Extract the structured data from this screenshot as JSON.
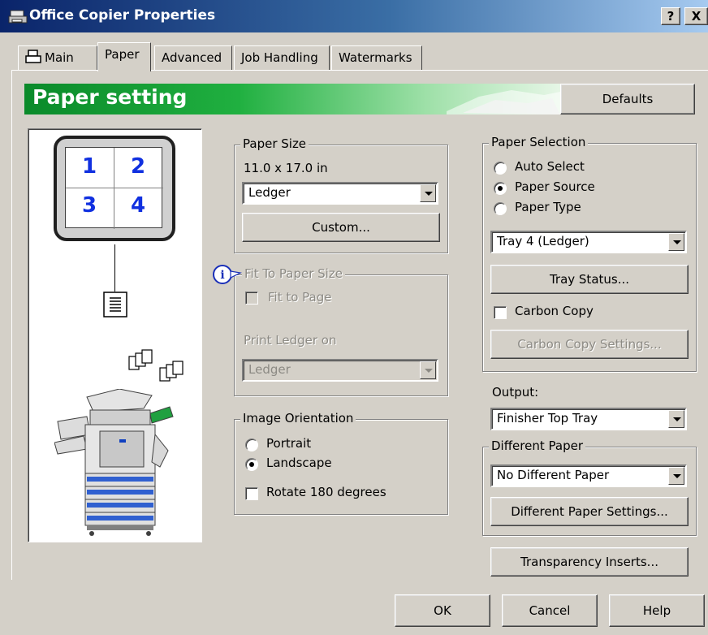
{
  "window": {
    "title": "Office Copier Properties",
    "help_button": "?",
    "close_button": "X"
  },
  "tabs": [
    {
      "label": "Main",
      "icon": "printer-icon"
    },
    {
      "label": "Paper",
      "active": true
    },
    {
      "label": "Advanced"
    },
    {
      "label": "Job Handling"
    },
    {
      "label": "Watermarks"
    }
  ],
  "banner": {
    "title": "Paper setting",
    "defaults_button": "Defaults"
  },
  "preview": {
    "page_numbers": [
      "1",
      "2",
      "3",
      "4"
    ]
  },
  "paper_size": {
    "legend": "Paper Size",
    "dimensions": "11.0 x 17.0 in",
    "selected": "Ledger",
    "custom_button": "Custom..."
  },
  "fit_to_paper": {
    "legend": "Fit To Paper Size",
    "fit_to_page_label": "Fit to Page",
    "fit_to_page_checked": false,
    "print_on_label": "Print Ledger on",
    "print_on_selected": "Ledger",
    "info_icon": "info-icon"
  },
  "image_orientation": {
    "legend": "Image Orientation",
    "options": [
      "Portrait",
      "Landscape"
    ],
    "selected": "Landscape",
    "rotate_label": "Rotate 180 degrees",
    "rotate_checked": false
  },
  "paper_selection": {
    "legend": "Paper Selection",
    "options": [
      "Auto Select",
      "Paper Source",
      "Paper Type"
    ],
    "selected": "Paper Source",
    "tray_selected": "Tray 4 (Ledger)",
    "tray_status_button": "Tray Status...",
    "carbon_copy_label": "Carbon Copy",
    "carbon_copy_checked": false,
    "carbon_copy_settings_button": "Carbon Copy Settings..."
  },
  "output": {
    "label": "Output:",
    "selected": "Finisher Top Tray"
  },
  "different_paper": {
    "legend": "Different Paper",
    "selected": "No Different Paper",
    "settings_button": "Different Paper Settings..."
  },
  "transparency_button": "Transparency Inserts...",
  "footer": {
    "ok": "OK",
    "cancel": "Cancel",
    "help": "Help"
  },
  "colors": {
    "titlebar_start": "#0a246a",
    "banner_green": "#20b040",
    "page_number_blue": "#1030e0",
    "dialog_face": "#d4d0c8"
  }
}
